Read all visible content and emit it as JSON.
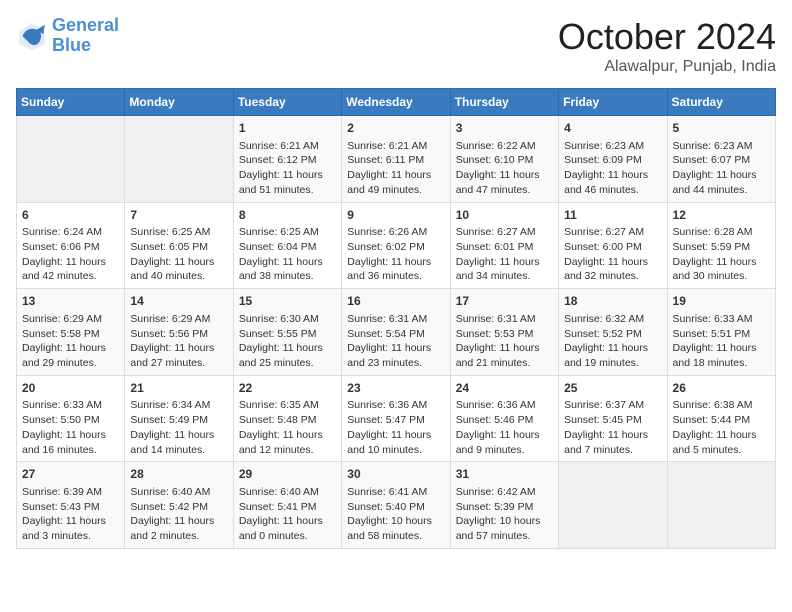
{
  "header": {
    "logo_general": "General",
    "logo_blue": "Blue",
    "month": "October 2024",
    "location": "Alawalpur, Punjab, India"
  },
  "days_of_week": [
    "Sunday",
    "Monday",
    "Tuesday",
    "Wednesday",
    "Thursday",
    "Friday",
    "Saturday"
  ],
  "weeks": [
    [
      {
        "day": "",
        "empty": true
      },
      {
        "day": "",
        "empty": true
      },
      {
        "day": "1",
        "sunrise": "Sunrise: 6:21 AM",
        "sunset": "Sunset: 6:12 PM",
        "daylight": "Daylight: 11 hours and 51 minutes."
      },
      {
        "day": "2",
        "sunrise": "Sunrise: 6:21 AM",
        "sunset": "Sunset: 6:11 PM",
        "daylight": "Daylight: 11 hours and 49 minutes."
      },
      {
        "day": "3",
        "sunrise": "Sunrise: 6:22 AM",
        "sunset": "Sunset: 6:10 PM",
        "daylight": "Daylight: 11 hours and 47 minutes."
      },
      {
        "day": "4",
        "sunrise": "Sunrise: 6:23 AM",
        "sunset": "Sunset: 6:09 PM",
        "daylight": "Daylight: 11 hours and 46 minutes."
      },
      {
        "day": "5",
        "sunrise": "Sunrise: 6:23 AM",
        "sunset": "Sunset: 6:07 PM",
        "daylight": "Daylight: 11 hours and 44 minutes."
      }
    ],
    [
      {
        "day": "6",
        "sunrise": "Sunrise: 6:24 AM",
        "sunset": "Sunset: 6:06 PM",
        "daylight": "Daylight: 11 hours and 42 minutes."
      },
      {
        "day": "7",
        "sunrise": "Sunrise: 6:25 AM",
        "sunset": "Sunset: 6:05 PM",
        "daylight": "Daylight: 11 hours and 40 minutes."
      },
      {
        "day": "8",
        "sunrise": "Sunrise: 6:25 AM",
        "sunset": "Sunset: 6:04 PM",
        "daylight": "Daylight: 11 hours and 38 minutes."
      },
      {
        "day": "9",
        "sunrise": "Sunrise: 6:26 AM",
        "sunset": "Sunset: 6:02 PM",
        "daylight": "Daylight: 11 hours and 36 minutes."
      },
      {
        "day": "10",
        "sunrise": "Sunrise: 6:27 AM",
        "sunset": "Sunset: 6:01 PM",
        "daylight": "Daylight: 11 hours and 34 minutes."
      },
      {
        "day": "11",
        "sunrise": "Sunrise: 6:27 AM",
        "sunset": "Sunset: 6:00 PM",
        "daylight": "Daylight: 11 hours and 32 minutes."
      },
      {
        "day": "12",
        "sunrise": "Sunrise: 6:28 AM",
        "sunset": "Sunset: 5:59 PM",
        "daylight": "Daylight: 11 hours and 30 minutes."
      }
    ],
    [
      {
        "day": "13",
        "sunrise": "Sunrise: 6:29 AM",
        "sunset": "Sunset: 5:58 PM",
        "daylight": "Daylight: 11 hours and 29 minutes."
      },
      {
        "day": "14",
        "sunrise": "Sunrise: 6:29 AM",
        "sunset": "Sunset: 5:56 PM",
        "daylight": "Daylight: 11 hours and 27 minutes."
      },
      {
        "day": "15",
        "sunrise": "Sunrise: 6:30 AM",
        "sunset": "Sunset: 5:55 PM",
        "daylight": "Daylight: 11 hours and 25 minutes."
      },
      {
        "day": "16",
        "sunrise": "Sunrise: 6:31 AM",
        "sunset": "Sunset: 5:54 PM",
        "daylight": "Daylight: 11 hours and 23 minutes."
      },
      {
        "day": "17",
        "sunrise": "Sunrise: 6:31 AM",
        "sunset": "Sunset: 5:53 PM",
        "daylight": "Daylight: 11 hours and 21 minutes."
      },
      {
        "day": "18",
        "sunrise": "Sunrise: 6:32 AM",
        "sunset": "Sunset: 5:52 PM",
        "daylight": "Daylight: 11 hours and 19 minutes."
      },
      {
        "day": "19",
        "sunrise": "Sunrise: 6:33 AM",
        "sunset": "Sunset: 5:51 PM",
        "daylight": "Daylight: 11 hours and 18 minutes."
      }
    ],
    [
      {
        "day": "20",
        "sunrise": "Sunrise: 6:33 AM",
        "sunset": "Sunset: 5:50 PM",
        "daylight": "Daylight: 11 hours and 16 minutes."
      },
      {
        "day": "21",
        "sunrise": "Sunrise: 6:34 AM",
        "sunset": "Sunset: 5:49 PM",
        "daylight": "Daylight: 11 hours and 14 minutes."
      },
      {
        "day": "22",
        "sunrise": "Sunrise: 6:35 AM",
        "sunset": "Sunset: 5:48 PM",
        "daylight": "Daylight: 11 hours and 12 minutes."
      },
      {
        "day": "23",
        "sunrise": "Sunrise: 6:36 AM",
        "sunset": "Sunset: 5:47 PM",
        "daylight": "Daylight: 11 hours and 10 minutes."
      },
      {
        "day": "24",
        "sunrise": "Sunrise: 6:36 AM",
        "sunset": "Sunset: 5:46 PM",
        "daylight": "Daylight: 11 hours and 9 minutes."
      },
      {
        "day": "25",
        "sunrise": "Sunrise: 6:37 AM",
        "sunset": "Sunset: 5:45 PM",
        "daylight": "Daylight: 11 hours and 7 minutes."
      },
      {
        "day": "26",
        "sunrise": "Sunrise: 6:38 AM",
        "sunset": "Sunset: 5:44 PM",
        "daylight": "Daylight: 11 hours and 5 minutes."
      }
    ],
    [
      {
        "day": "27",
        "sunrise": "Sunrise: 6:39 AM",
        "sunset": "Sunset: 5:43 PM",
        "daylight": "Daylight: 11 hours and 3 minutes."
      },
      {
        "day": "28",
        "sunrise": "Sunrise: 6:40 AM",
        "sunset": "Sunset: 5:42 PM",
        "daylight": "Daylight: 11 hours and 2 minutes."
      },
      {
        "day": "29",
        "sunrise": "Sunrise: 6:40 AM",
        "sunset": "Sunset: 5:41 PM",
        "daylight": "Daylight: 11 hours and 0 minutes."
      },
      {
        "day": "30",
        "sunrise": "Sunrise: 6:41 AM",
        "sunset": "Sunset: 5:40 PM",
        "daylight": "Daylight: 10 hours and 58 minutes."
      },
      {
        "day": "31",
        "sunrise": "Sunrise: 6:42 AM",
        "sunset": "Sunset: 5:39 PM",
        "daylight": "Daylight: 10 hours and 57 minutes."
      },
      {
        "day": "",
        "empty": true
      },
      {
        "day": "",
        "empty": true
      }
    ]
  ]
}
